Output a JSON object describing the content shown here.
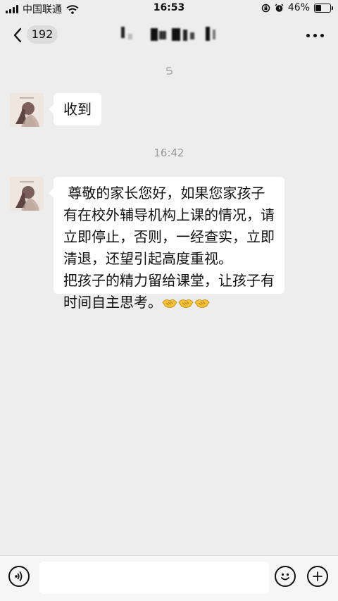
{
  "status_bar": {
    "carrier": "中国联通",
    "time": "16:53",
    "battery": "46%",
    "battery_level": 0.46
  },
  "nav": {
    "unread_count": "192"
  },
  "messages": [
    {
      "text": "收到"
    },
    {
      "text_lines": [
        " 尊敬的家长您好，如果您家孩子",
        "有在校外辅导机构上课的情况，请",
        "立即停止，否则，一经查实，立即",
        "清退，还望引起高度重视。",
        "把孩子的精力留给课堂，让孩子有",
        "时间自主思考。"
      ]
    }
  ],
  "timestamp": "16:42",
  "icons": {
    "voice": "voice-icon",
    "emoji": "emoji-icon",
    "add": "plus-icon",
    "back": "back-icon",
    "more": "more-icon",
    "handshake": "handshake-emoji"
  },
  "colors": {
    "background": "#ededed",
    "bubble": "#ffffff",
    "timestamp_text": "#9a9a9a"
  }
}
